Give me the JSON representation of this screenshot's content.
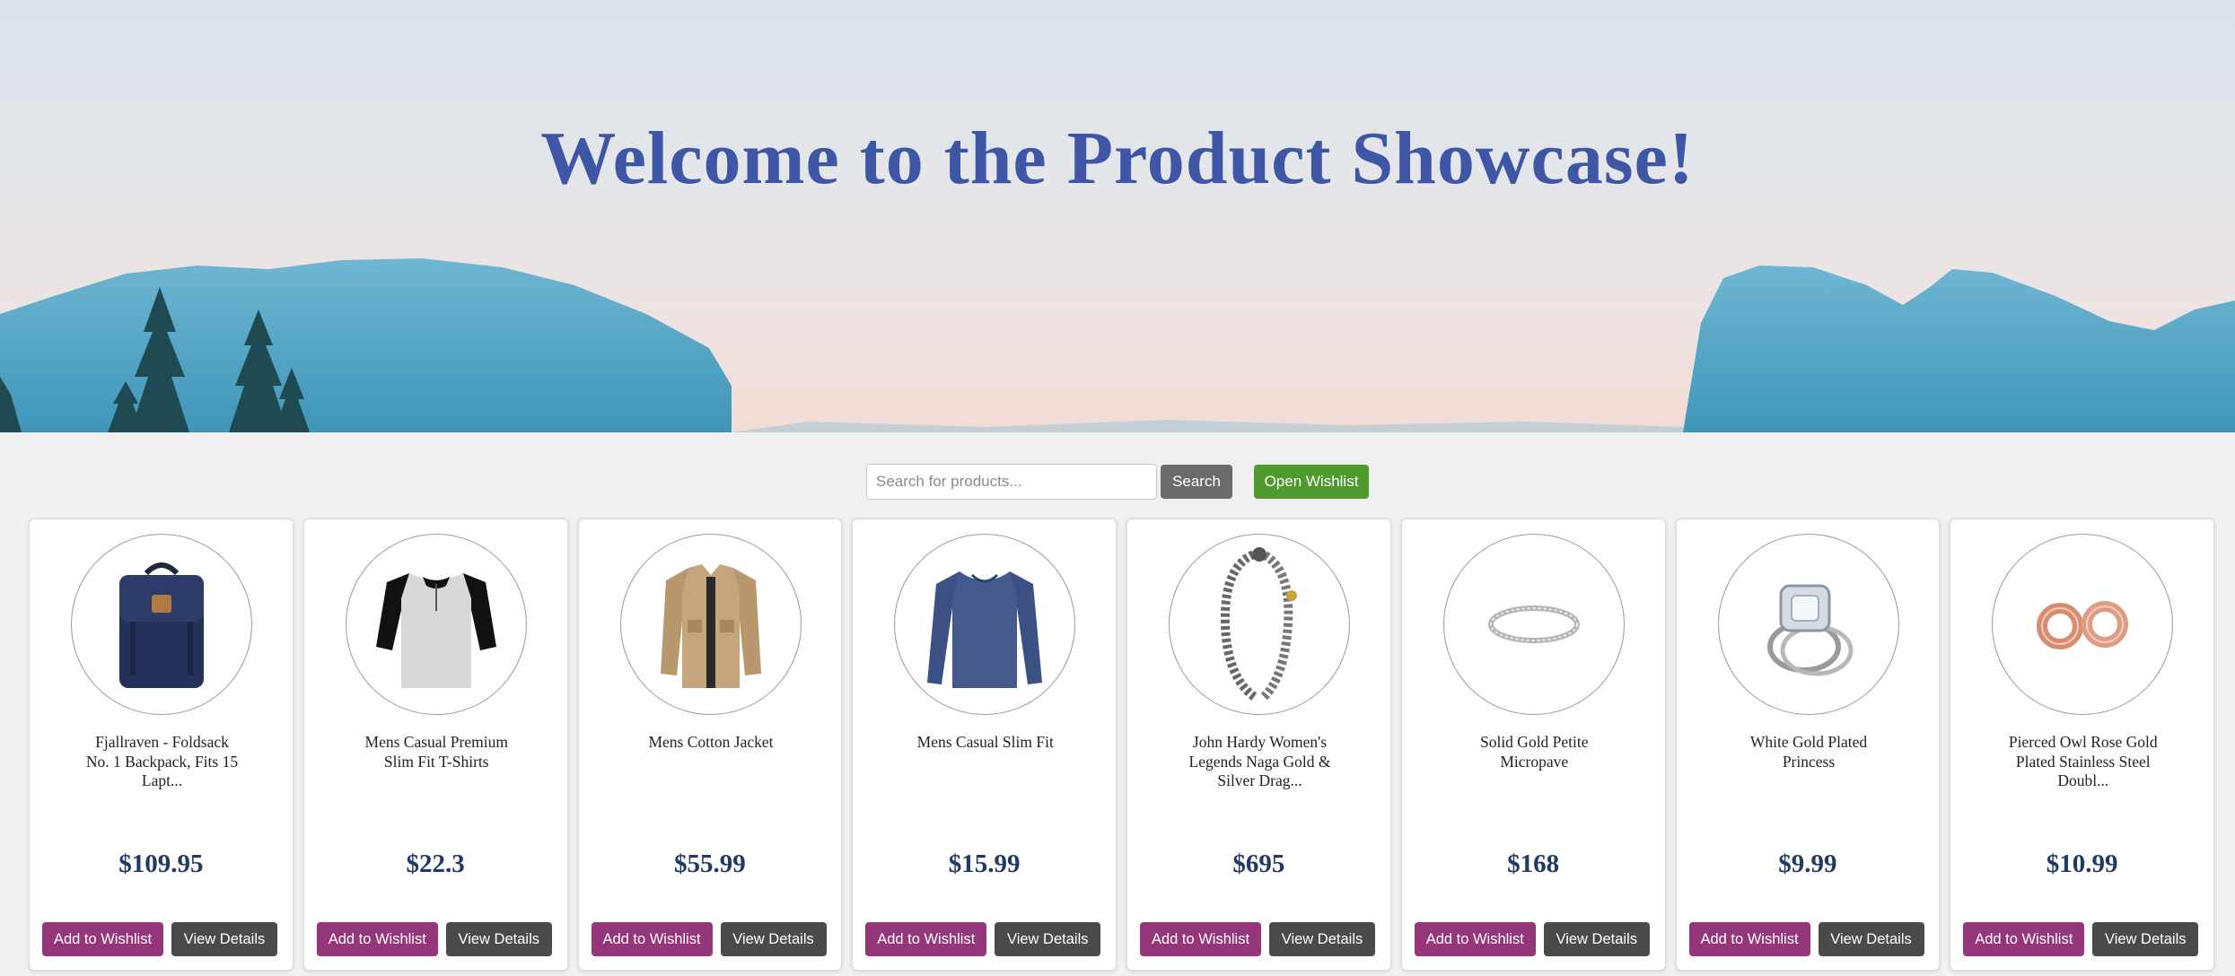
{
  "hero": {
    "title": "Welcome to the Product Showcase!"
  },
  "toolbar": {
    "search_placeholder": "Search for products...",
    "search_label": "Search",
    "open_wishlist_label": "Open Wishlist"
  },
  "buttons": {
    "add_to_wishlist": "Add to Wishlist",
    "view_details": "View Details"
  },
  "colors": {
    "title": "#3f55a6",
    "price": "#1f3a66",
    "wishlist_button": "#95357a",
    "details_button": "#4a4a4a",
    "open_wishlist_button": "#4e9a2d",
    "search_button": "#6b6b6b"
  },
  "products": [
    {
      "name": "Fjallraven - Foldsack No. 1 Backpack, Fits 15 Lapt...",
      "price": "$109.95",
      "icon": "backpack-icon"
    },
    {
      "name": "Mens Casual Premium Slim Fit T-Shirts",
      "price": "$22.3",
      "icon": "tshirt-icon"
    },
    {
      "name": "Mens Cotton Jacket",
      "price": "$55.99",
      "icon": "jacket-icon"
    },
    {
      "name": "Mens Casual Slim Fit",
      "price": "$15.99",
      "icon": "longsleeve-icon"
    },
    {
      "name": "John Hardy Women's Legends Naga Gold & Silver Drag...",
      "price": "$695",
      "icon": "bracelet-icon"
    },
    {
      "name": "Solid Gold Petite Micropave",
      "price": "$168",
      "icon": "ring-icon"
    },
    {
      "name": "White Gold Plated Princess",
      "price": "$9.99",
      "icon": "diamond-ring-icon"
    },
    {
      "name": "Pierced Owl Rose Gold Plated Stainless Steel Doubl...",
      "price": "$10.99",
      "icon": "earrings-icon"
    }
  ]
}
